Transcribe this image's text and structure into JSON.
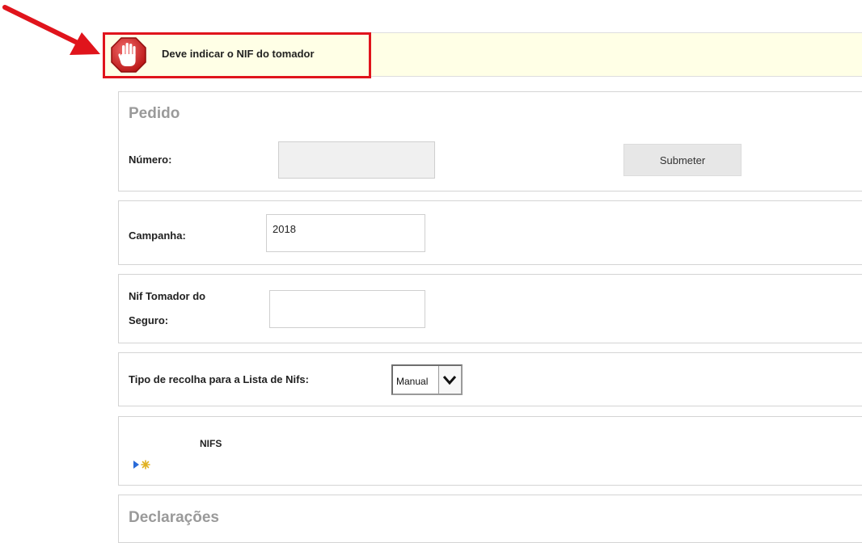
{
  "alert": {
    "message": "Deve indicar o NIF do tomador",
    "icon": "stop-hand-icon",
    "highlight_color": "#e0141c",
    "background": "#ffffe6"
  },
  "annotation": {
    "icon": "red-arrow-icon"
  },
  "pedido": {
    "title": "Pedido",
    "numero_label": "Número:",
    "numero_value": "",
    "submit_label": "Submeter"
  },
  "campanha": {
    "label": "Campanha:",
    "value": "2018"
  },
  "nif": {
    "label_line1": "Nif Tomador do",
    "label_line2": "Seguro:",
    "value": ""
  },
  "recolha": {
    "label": "Tipo de recolha para a Lista de Nifs:",
    "selected": "Manual"
  },
  "nifs": {
    "label": "NIFS",
    "icon": "expand-new-icon"
  },
  "declaracoes": {
    "title": "Declarações"
  }
}
